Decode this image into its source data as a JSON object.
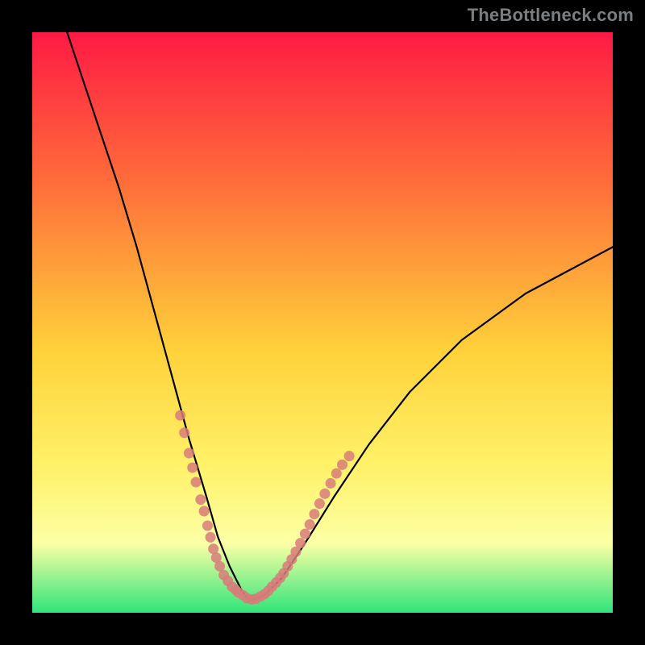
{
  "watermark": "TheBottleneck.com",
  "colors": {
    "bg": "#000000",
    "watermark": "#7b7e81",
    "curve": "#000000",
    "dot_fill": "#d87b79",
    "grad_top": "#ff1a44",
    "grad_mid1": "#ff6a3a",
    "grad_mid2": "#ffd23a",
    "grad_mid3": "#fff26a",
    "grad_mid4": "#fcffa5",
    "grad_bottom": "#2fe57a"
  },
  "chart_data": {
    "type": "line",
    "title": "",
    "xlabel": "",
    "ylabel": "",
    "xlim": [
      0,
      100
    ],
    "ylim": [
      0,
      100
    ],
    "series": [
      {
        "name": "bottleneck-curve",
        "x": [
          0,
          3,
          6,
          9,
          12,
          15,
          18,
          21,
          24,
          27,
          30,
          32,
          34,
          36,
          37,
          38,
          40,
          43,
          47,
          52,
          58,
          65,
          74,
          85,
          100
        ],
        "y": [
          115,
          108,
          100,
          91,
          82,
          73,
          63,
          52,
          41,
          30,
          20,
          13,
          8,
          4,
          2.5,
          2.3,
          3,
          6,
          12,
          20,
          29,
          38,
          47,
          55,
          63
        ]
      }
    ],
    "scatter": [
      {
        "name": "left-cluster",
        "points": [
          {
            "x": 25.5,
            "y": 34
          },
          {
            "x": 26.2,
            "y": 31
          },
          {
            "x": 27.0,
            "y": 27.5
          },
          {
            "x": 27.6,
            "y": 25
          },
          {
            "x": 28.2,
            "y": 22.5
          },
          {
            "x": 29.0,
            "y": 19.5
          },
          {
            "x": 29.6,
            "y": 17.5
          },
          {
            "x": 30.2,
            "y": 15
          },
          {
            "x": 30.7,
            "y": 13
          },
          {
            "x": 31.2,
            "y": 11
          },
          {
            "x": 31.7,
            "y": 9.5
          },
          {
            "x": 32.3,
            "y": 8
          },
          {
            "x": 33.0,
            "y": 6.5
          },
          {
            "x": 33.7,
            "y": 5.5
          },
          {
            "x": 34.4,
            "y": 4.5
          },
          {
            "x": 35.0,
            "y": 4.0
          }
        ]
      },
      {
        "name": "bottom-cluster",
        "points": [
          {
            "x": 35.5,
            "y": 3.5
          },
          {
            "x": 36.3,
            "y": 3.0
          },
          {
            "x": 37.0,
            "y": 2.5
          },
          {
            "x": 37.8,
            "y": 2.3
          },
          {
            "x": 38.5,
            "y": 2.4
          },
          {
            "x": 39.3,
            "y": 2.8
          },
          {
            "x": 40.0,
            "y": 3.2
          },
          {
            "x": 40.7,
            "y": 3.8
          }
        ]
      },
      {
        "name": "right-cluster",
        "points": [
          {
            "x": 41.3,
            "y": 4.5
          },
          {
            "x": 42.0,
            "y": 5.2
          },
          {
            "x": 42.7,
            "y": 6.0
          },
          {
            "x": 43.3,
            "y": 6.8
          },
          {
            "x": 44.0,
            "y": 8.0
          },
          {
            "x": 44.7,
            "y": 9.2
          },
          {
            "x": 45.4,
            "y": 10.5
          },
          {
            "x": 46.2,
            "y": 12.0
          },
          {
            "x": 47.0,
            "y": 13.6
          },
          {
            "x": 47.8,
            "y": 15.2
          },
          {
            "x": 48.6,
            "y": 17.0
          },
          {
            "x": 49.5,
            "y": 18.8
          },
          {
            "x": 50.4,
            "y": 20.5
          },
          {
            "x": 51.4,
            "y": 22.3
          },
          {
            "x": 52.4,
            "y": 24
          },
          {
            "x": 53.4,
            "y": 25.5
          },
          {
            "x": 54.6,
            "y": 27
          }
        ]
      }
    ],
    "gradient_stops": [
      {
        "offset": 0.0,
        "color": "#ff1a44"
      },
      {
        "offset": 0.25,
        "color": "#ff6a3a"
      },
      {
        "offset": 0.55,
        "color": "#ffd23a"
      },
      {
        "offset": 0.75,
        "color": "#fff26a"
      },
      {
        "offset": 0.88,
        "color": "#fcffa5"
      },
      {
        "offset": 1.0,
        "color": "#2fe57a"
      }
    ]
  }
}
